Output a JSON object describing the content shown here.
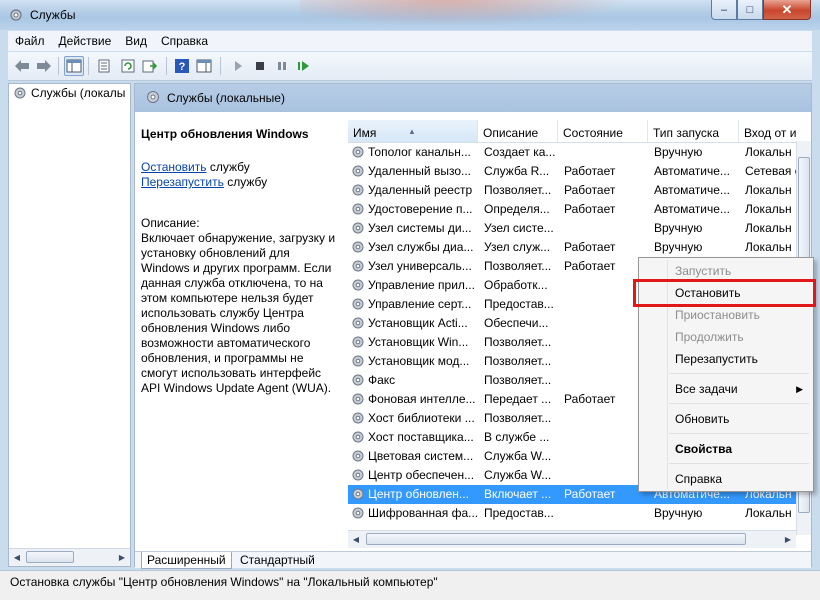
{
  "window": {
    "title": "Службы",
    "min_label": "–",
    "max_label": "□",
    "close_label": "✕"
  },
  "menu": [
    "Файл",
    "Действие",
    "Вид",
    "Справка"
  ],
  "tree": {
    "root_label": "Службы (локалы"
  },
  "pane": {
    "title": "Службы (локальные)",
    "service_name": "Центр обновления Windows",
    "stop_link": "Остановить",
    "stop_suffix": " службу",
    "restart_link": "Перезапустить",
    "restart_suffix": " службу",
    "desc_label": "Описание:",
    "desc_lines": [
      "Включает обнаружение, загрузку и",
      "установку обновлений для",
      "Windows и других программ. Если",
      "данная служба отключена, то на",
      "этом компьютере нельзя будет",
      "использовать службу Центра",
      "обновления Windows либо",
      "возможности автоматического",
      "обновления, и программы не",
      "смогут использовать интерфейс",
      "API Windows Update Agent (WUA)."
    ]
  },
  "columns": [
    "Имя",
    "Описание",
    "Состояние",
    "Тип запуска",
    "Вход от и"
  ],
  "rows": [
    {
      "name": "Тополог канальн...",
      "desc": "Создает ка...",
      "state": "",
      "start": "Вручную",
      "logon": "Локальн"
    },
    {
      "name": "Удаленный вызо...",
      "desc": "Служба R...",
      "state": "Работает",
      "start": "Автоматиче...",
      "logon": "Сетевая с"
    },
    {
      "name": "Удаленный реестр",
      "desc": "Позволяет...",
      "state": "Работает",
      "start": "Автоматиче...",
      "logon": "Локальн"
    },
    {
      "name": "Удостоверение п...",
      "desc": "Определя...",
      "state": "Работает",
      "start": "Автоматиче...",
      "logon": "Локальн"
    },
    {
      "name": "Узел системы ди...",
      "desc": "Узел систе...",
      "state": "",
      "start": "Вручную",
      "logon": "Локальн"
    },
    {
      "name": "Узел службы диа...",
      "desc": "Узел служ...",
      "state": "Работает",
      "start": "Вручную",
      "logon": "Локальн"
    },
    {
      "name": "Узел универсаль...",
      "desc": "Позволяет...",
      "state": "Работает",
      "start": "",
      "logon": ""
    },
    {
      "name": "Управление прил...",
      "desc": "Обработк...",
      "state": "",
      "start": "",
      "logon": ""
    },
    {
      "name": "Управление серт...",
      "desc": "Предостав...",
      "state": "",
      "start": "",
      "logon": ""
    },
    {
      "name": "Установщик Acti...",
      "desc": "Обеспечи...",
      "state": "",
      "start": "",
      "logon": ""
    },
    {
      "name": "Установщик Win...",
      "desc": "Позволяет...",
      "state": "",
      "start": "",
      "logon": ""
    },
    {
      "name": "Установщик мод...",
      "desc": "Позволяет...",
      "state": "",
      "start": "",
      "logon": ""
    },
    {
      "name": "Факс",
      "desc": "Позволяет...",
      "state": "",
      "start": "",
      "logon": ""
    },
    {
      "name": "Фоновая интелле...",
      "desc": "Передает ...",
      "state": "Работает",
      "start": "",
      "logon": ""
    },
    {
      "name": "Хост библиотеки ...",
      "desc": "Позволяет...",
      "state": "",
      "start": "",
      "logon": ""
    },
    {
      "name": "Хост поставщика...",
      "desc": "В службе ...",
      "state": "",
      "start": "",
      "logon": ""
    },
    {
      "name": "Цветовая систем...",
      "desc": "Служба W...",
      "state": "",
      "start": "",
      "logon": ""
    },
    {
      "name": "Центр обеспечен...",
      "desc": "Служба W...",
      "state": "",
      "start": "",
      "logon": ""
    },
    {
      "name": "Центр обновлен...",
      "desc": "Включает ...",
      "state": "Работает",
      "start": "Автоматиче...",
      "logon": "Локальн",
      "selected": true
    },
    {
      "name": "Шифрованная фа...",
      "desc": "Предостав...",
      "state": "",
      "start": "Вручную",
      "logon": "Локальн"
    }
  ],
  "tabs": [
    "Расширенный",
    "Стандартный"
  ],
  "context_menu": [
    {
      "label": "Запустить",
      "disabled": true
    },
    {
      "label": "Остановить",
      "disabled": false,
      "highlighted": true
    },
    {
      "label": "Приостановить",
      "disabled": true
    },
    {
      "label": "Продолжить",
      "disabled": true
    },
    {
      "label": "Перезапустить",
      "disabled": false
    },
    {
      "label": "Все задачи",
      "disabled": false,
      "submenu": true
    },
    {
      "label": "Обновить",
      "disabled": false
    },
    {
      "label": "Свойства",
      "disabled": false,
      "bold": true
    },
    {
      "label": "Справка",
      "disabled": false
    }
  ],
  "status": "Остановка службы \"Центр обновления Windows\" на \"Локальный компьютер\"",
  "colors": {
    "accent_red": "#e01818",
    "selection": "#3399ff",
    "link": "#0645ad"
  }
}
